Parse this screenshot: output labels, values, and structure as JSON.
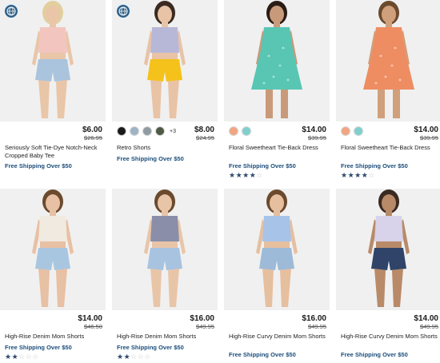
{
  "products": [
    {
      "name": "Seriously Soft Tie-Dye Notch-Neck Cropped Baby Tee",
      "price": "$6.00",
      "original_price": "$26.95",
      "shipping": "Free Shipping Over $50",
      "badge": "globe-icon",
      "swatches": [],
      "more": "",
      "rating": null,
      "colors": {
        "top": "#f2c6bf",
        "bottom": "#a9c4dc",
        "skin": "#e9c6a8",
        "hair": "#e2cf9e"
      }
    },
    {
      "name": "Retro Shorts",
      "price": "$8.00",
      "original_price": "$24.95",
      "shipping": "Free Shipping Over $50",
      "badge": "globe-icon",
      "swatches": [
        "#1a1a1a",
        "#9fb3c6",
        "#8f9aa3",
        "#4f5a44"
      ],
      "more": "+3",
      "rating": null,
      "colors": {
        "top": "#b7b8d8",
        "bottom": "#f4c21b",
        "skin": "#e8c3a6",
        "hair": "#3b2a22"
      }
    },
    {
      "name": "Floral Sweetheart Tie-Back Dress",
      "price": "$14.00",
      "original_price": "$39.95",
      "shipping": "Free Shipping Over $50",
      "badge": "",
      "swatches": [
        "#f2a583",
        "#7fd0cf"
      ],
      "more": "",
      "rating": 4,
      "colors": {
        "top": "#58c6b3",
        "bottom": "#58c6b3",
        "skin": "#c99a7a",
        "hair": "#2a1c16"
      }
    },
    {
      "name": "Floral Sweetheart Tie-Back Dress",
      "price": "$14.00",
      "original_price": "$39.95",
      "shipping": "Free Shipping Over $50",
      "badge": "",
      "swatches": [
        "#f2a583",
        "#7fd0cf"
      ],
      "more": "",
      "rating": 4,
      "colors": {
        "top": "#ee8d62",
        "bottom": "#ee8d62",
        "skin": "#d0a07c",
        "hair": "#6b4a2e"
      }
    },
    {
      "name": "High-Rise Denim Mom Shorts",
      "price": "$14.00",
      "original_price": "$46.50",
      "shipping": "Free Shipping Over $50",
      "badge": "",
      "swatches": [],
      "more": "",
      "rating": 2,
      "colors": {
        "top": "#f0eae0",
        "bottom": "#a9c6e0",
        "skin": "#e8c0a3",
        "hair": "#6b4a2e"
      }
    },
    {
      "name": "High-Rise Denim Mom Shorts",
      "price": "$16.00",
      "original_price": "$49.95",
      "shipping": "Free Shipping Over $50",
      "badge": "",
      "swatches": [],
      "more": "",
      "rating": 2,
      "colors": {
        "top": "#8a8ea8",
        "bottom": "#a7c3e0",
        "skin": "#e9c5a8",
        "hair": "#6b4a2e"
      }
    },
    {
      "name": "High-Rise Curvy Denim Mom Shorts",
      "price": "$16.00",
      "original_price": "$49.95",
      "shipping": "Free Shipping Over $50",
      "badge": "",
      "swatches": [],
      "more": "",
      "rating": null,
      "colors": {
        "top": "#a7c3e8",
        "bottom": "#9dbad8",
        "skin": "#e6bf9f",
        "hair": "#6b4a2e"
      }
    },
    {
      "name": "High-Rise Curvy Denim Mom Shorts",
      "price": "$14.00",
      "original_price": "$49.95",
      "shipping": "Free Shipping Over $50",
      "badge": "",
      "swatches": [],
      "more": "",
      "rating": null,
      "colors": {
        "top": "#d8d2ea",
        "bottom": "#2f4468",
        "skin": "#b88a68",
        "hair": "#3b2a22"
      }
    }
  ],
  "colors": {
    "shipping": "#1b4e7c",
    "star_on": "#2e4a6b",
    "star_off": "#c9c9c9",
    "badge": "#2f5f86"
  }
}
